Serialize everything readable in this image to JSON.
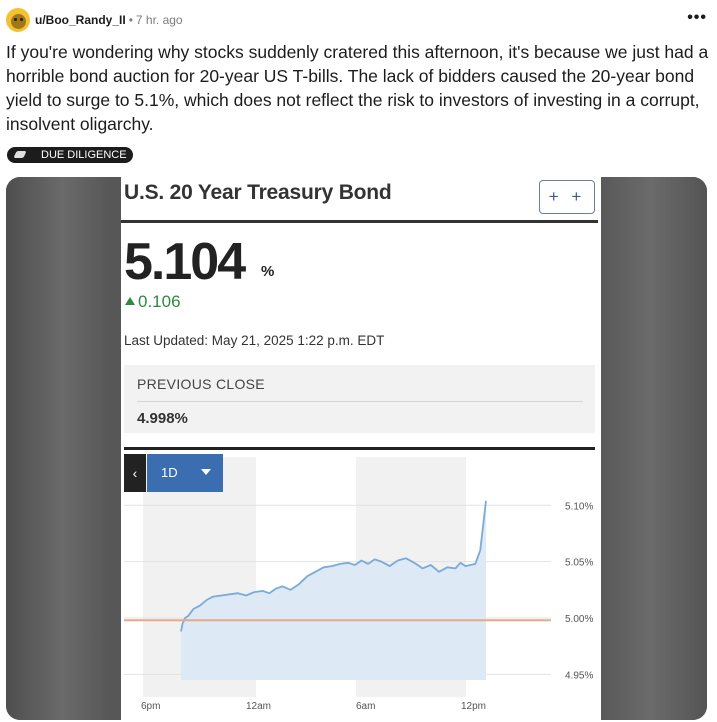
{
  "post": {
    "username": "u/Boo_Randy_II",
    "separator": "•",
    "time_ago": "7 hr. ago",
    "more_label": "•••",
    "body": "If you're wondering why stocks suddenly cratered this afternoon, it's because we just had a horrible bond auction for 20-year US T-bills. The lack of bidders caused the 20-year bond yield to surge to 5.1%, which does not reflect the risk to investors of investing in a corrupt, insolvent oligarchy.",
    "flair": "DUE DILIGENCE"
  },
  "quote": {
    "title": "U.S. 20 Year Treasury Bond",
    "add_button": "+ +",
    "value": "5.104",
    "unit": "%",
    "change": "0.106",
    "last_updated": "Last Updated: May 21, 2025 1:22 p.m. EDT",
    "previous_close_label": "PREVIOUS CLOSE",
    "previous_close_value": "4.998%",
    "nav_prev": "‹",
    "range": "1D",
    "colors": {
      "line": "#7aaadb",
      "area": "#dde9f5",
      "previous_close_line": "#e5a98a",
      "session_shade": "#f1f1f1",
      "up": "#2e8a3e",
      "range_button": "#3b6eb0"
    }
  },
  "chart_data": {
    "type": "area",
    "title": "",
    "xlabel": "",
    "ylabel": "",
    "x_ticks": [
      "6pm",
      "12am",
      "6am",
      "12pm"
    ],
    "y_ticks": [
      "4.95%",
      "5.00%",
      "5.05%",
      "5.10%"
    ],
    "ylim": [
      4.945,
      5.11
    ],
    "reference_line": 4.998,
    "x_unit": "hours since 6pm (May 20, 2025, EDT)",
    "series": [
      {
        "x": [
          0.85,
          0.95,
          1.1,
          1.3,
          1.6,
          2.0,
          2.4,
          2.8,
          3.3,
          3.8,
          4.3,
          4.8,
          5.3,
          5.8,
          6.2,
          6.6,
          7.0,
          7.5,
          8.0,
          8.5,
          9.0,
          9.5,
          10.0,
          10.5,
          11.0,
          11.4,
          11.8,
          12.2,
          12.6,
          13.0,
          13.5,
          14.0,
          14.5,
          15.0,
          15.5,
          16.0,
          16.5,
          17.0,
          17.5,
          17.8,
          18.1,
          18.4,
          18.7,
          19.0,
          19.2,
          19.35
        ],
        "values": [
          4.988,
          4.995,
          5.0,
          5.002,
          5.008,
          5.011,
          5.016,
          5.019,
          5.02,
          5.021,
          5.022,
          5.02,
          5.023,
          5.024,
          5.022,
          5.026,
          5.028,
          5.025,
          5.03,
          5.037,
          5.041,
          5.045,
          5.046,
          5.048,
          5.049,
          5.047,
          5.051,
          5.048,
          5.052,
          5.05,
          5.046,
          5.051,
          5.053,
          5.049,
          5.044,
          5.047,
          5.041,
          5.045,
          5.044,
          5.049,
          5.046,
          5.047,
          5.048,
          5.06,
          5.085,
          5.104
        ]
      }
    ],
    "grid": true
  }
}
